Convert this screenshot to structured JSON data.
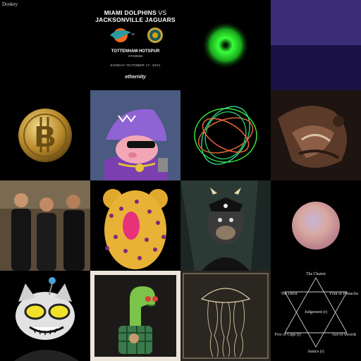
{
  "gallery": {
    "label": "Donkey",
    "tiles": [
      {
        "id": "match-poster",
        "team_a": "MIAMI DOLPHINS",
        "vs": "VS",
        "team_b": "JACKSONVILLE JAGUARS",
        "vs_small": "vs",
        "venue": "TOTTENHAM HOTSPUR",
        "venue_sub": "STADIUM",
        "date": "SUNDAY OCTOBER 17, 2021",
        "brand": "ethernity"
      },
      {
        "id": "green-orb"
      },
      {
        "id": "purple-gradient"
      },
      {
        "id": "bitcoin-coin"
      },
      {
        "id": "pig-shark-cartoon"
      },
      {
        "id": "green-wireframe-sphere"
      },
      {
        "id": "abstract-painting"
      },
      {
        "id": "three-men-photo"
      },
      {
        "id": "leopard-bear"
      },
      {
        "id": "pirate-ape"
      },
      {
        "id": "pastel-orb"
      },
      {
        "id": "robot-cat"
      },
      {
        "id": "dino-plant"
      },
      {
        "id": "jellyfish-drawing"
      },
      {
        "id": "tarot-hexagram",
        "cards": [
          "The Chariot",
          "The Devil",
          "Four of Pentacles",
          "Judgement (r)",
          "Five of Cups (r)",
          "Ace of Swords",
          "Justice (r)"
        ]
      }
    ]
  },
  "colors": {
    "background": "#000000",
    "purple_top": "#3b2c78",
    "purple_bottom": "#1a1244",
    "orb_green": "#39ff3a",
    "gold": "#c9a43a"
  }
}
